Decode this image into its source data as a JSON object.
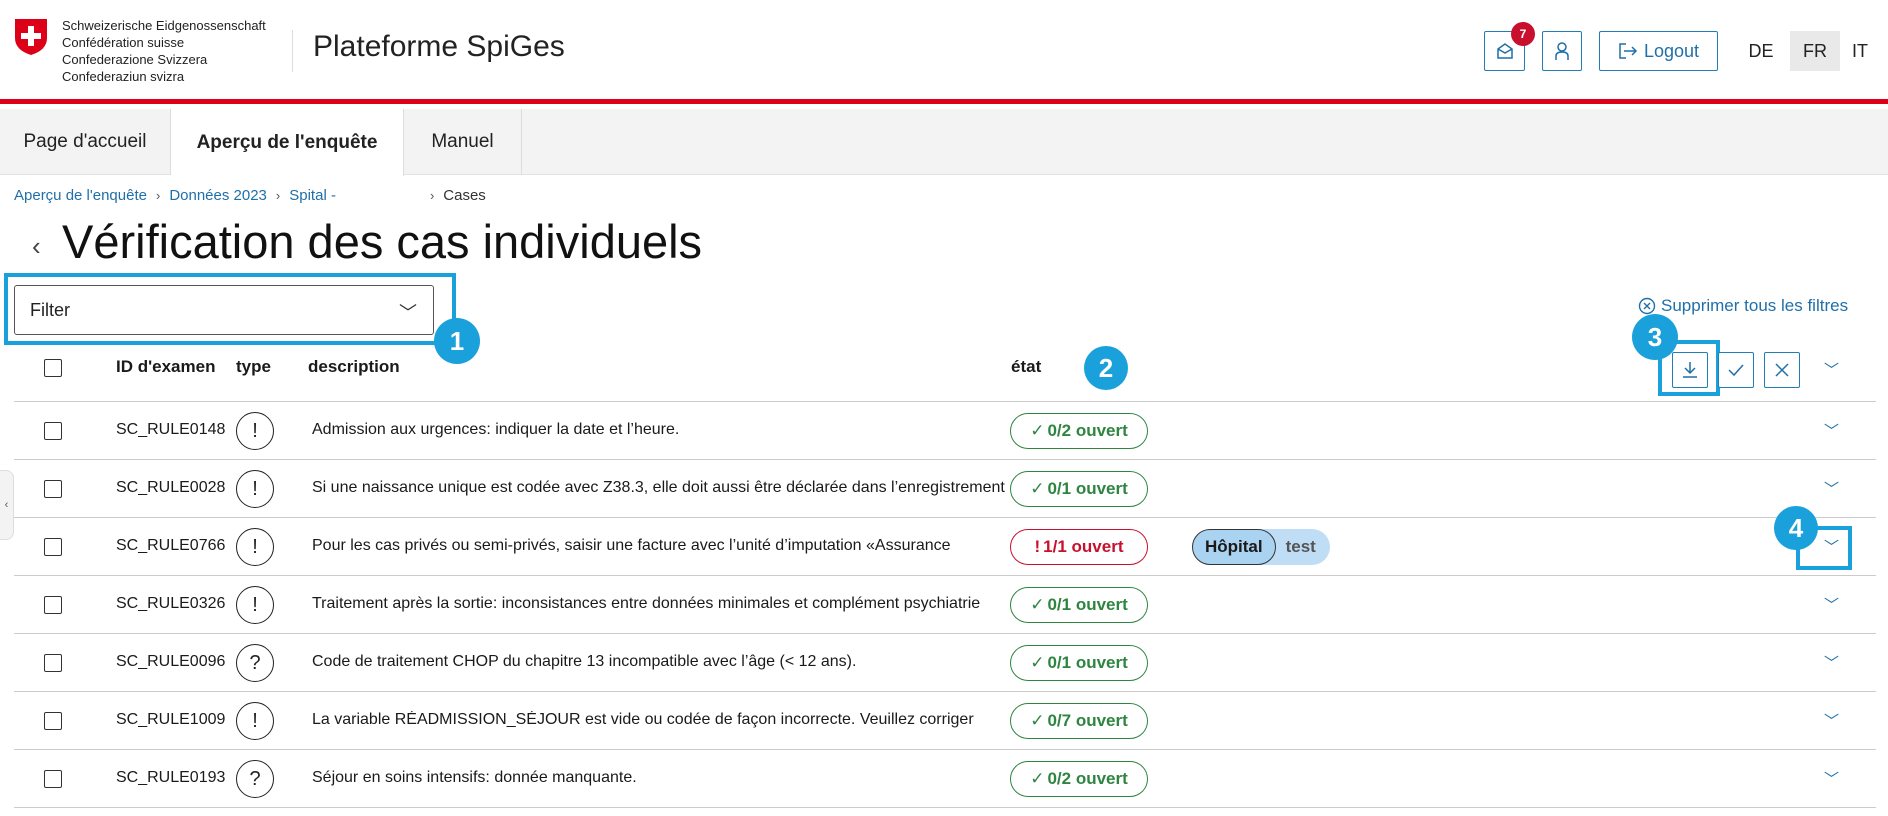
{
  "header": {
    "confederation_lines": [
      "Schweizerische Eidgenossenschaft",
      "Confédération suisse",
      "Confederazione Svizzera",
      "Confederaziun svizra"
    ],
    "site_title": "Plateforme SpiGes",
    "notification_count": "7",
    "logout_label": "Logout",
    "languages": [
      "DE",
      "FR",
      "IT"
    ],
    "active_language": "FR",
    "brand_red": "#dc0018"
  },
  "nav": {
    "tabs": [
      {
        "label": "Page d'accueil",
        "active": false
      },
      {
        "label": "Aperçu de l'enquête",
        "active": true
      },
      {
        "label": "Manuel",
        "active": false
      }
    ]
  },
  "breadcrumb": {
    "items": [
      "Aperçu de l'enquête",
      "Données 2023",
      "Spital -"
    ],
    "current": "Cases"
  },
  "page": {
    "title": "Vérification des cas individuels"
  },
  "filter": {
    "placeholder": "Filter",
    "clear_label": "Supprimer tous les filtres"
  },
  "callouts": [
    "1",
    "2",
    "3",
    "4"
  ],
  "table": {
    "columns": {
      "id": "ID d'examen",
      "type": "type",
      "description": "description",
      "state": "état"
    },
    "rows": [
      {
        "id": "SC_RULE0148",
        "type": "!",
        "description": "Admission aux urgences: indiquer la date et l’heure.",
        "status": "0/2 ouvert",
        "status_kind": "ok"
      },
      {
        "id": "SC_RULE0028",
        "type": "!",
        "description": "Si une naissance unique est codée avec Z38.3, elle doit aussi être déclarée dans l’enregistrement",
        "status": "0/1 ouvert",
        "status_kind": "ok"
      },
      {
        "id": "SC_RULE0766",
        "type": "!",
        "description": "Pour les cas privés ou semi-privés, saisir une facture avec l’unité d’imputation «Assurance",
        "status": "1/1 ouvert",
        "status_kind": "open",
        "tags": [
          "Hôpital",
          "test"
        ]
      },
      {
        "id": "SC_RULE0326",
        "type": "!",
        "description": "Traitement après la sortie: inconsistances entre données minimales et complément psychiatrie",
        "status": "0/1 ouvert",
        "status_kind": "ok"
      },
      {
        "id": "SC_RULE0096",
        "type": "?",
        "description": "Code de traitement CHOP du chapitre 13 incompatible avec l’âge (< 12 ans).",
        "status": "0/1 ouvert",
        "status_kind": "ok"
      },
      {
        "id": "SC_RULE1009",
        "type": "!",
        "description": "La variable RÉADMISSION_SÉJOUR est vide ou codée de façon incorrecte. Veuillez corriger",
        "status": "0/7 ouvert",
        "status_kind": "ok"
      },
      {
        "id": "SC_RULE0193",
        "type": "?",
        "description": "Séjour en soins intensifs: donnée manquante.",
        "status": "0/2 ouvert",
        "status_kind": "ok"
      }
    ]
  },
  "colors": {
    "accent": "#1aa1dc",
    "link": "#1f6fa8",
    "ok": "#2e8540",
    "open": "#c8102e"
  }
}
